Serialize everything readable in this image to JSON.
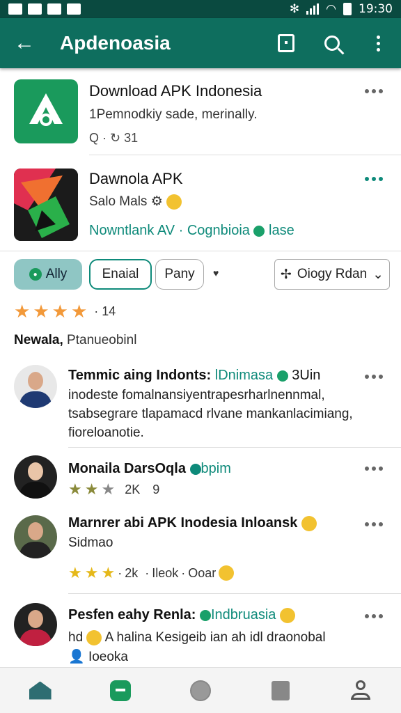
{
  "status_bar": {
    "time": "19:30"
  },
  "app_bar": {
    "title": "Apdenoasia",
    "back_icon": "arrow-left-icon",
    "actions": [
      "square-icon",
      "search-icon",
      "more-vert-icon"
    ]
  },
  "apps": [
    {
      "title": "Download APK Indonesia",
      "subtitle": "1Pemnodkiy sade, merinally.",
      "meta_icon": "search-icon",
      "meta_count": "31"
    },
    {
      "title": "Dawnola APK",
      "subtitle": "Salo Mals",
      "link": "Nowntlank AV",
      "link_extra": "Cognbioia",
      "link_tail": "lase"
    }
  ],
  "filters": {
    "app_chip": "Ally",
    "chip1": "Enaial",
    "chip2": "Pany",
    "sort": "Oiogy Rdan"
  },
  "rating": {
    "value": 4,
    "count": "14"
  },
  "section": {
    "label": "Newala,",
    "sub": "Ptanueobinl"
  },
  "reviews": [
    {
      "name": "Temmic aing Indonts:",
      "tag": "lDnimasa",
      "tail": "3Uin",
      "text": "inodeste fomalnansiyentrapesrharlnennmal, tsabsegrare tlapamacd rlvane mankanlacimiang, fioreloanotie."
    },
    {
      "name": "Monaila DarsOqla",
      "tag": "bpim",
      "rating": 3,
      "count": "2K",
      "extra": "9"
    },
    {
      "name": "Marnrer abi APK Inodesia Inloansk",
      "text": "Sidmao",
      "rating": 3,
      "count": "2k",
      "extra": "Ileok",
      "extra2": "Ooar"
    },
    {
      "name": "Pesfen eahy Renla:",
      "tag": "Indbruasia",
      "text": "hd",
      "text2": "A halina Kesigeib ian ah idl draonobal",
      "text3": "Ioeoka"
    }
  ],
  "bottom_nav": [
    "home-icon",
    "chat-icon",
    "circle-icon",
    "square-icon",
    "profile-icon"
  ]
}
